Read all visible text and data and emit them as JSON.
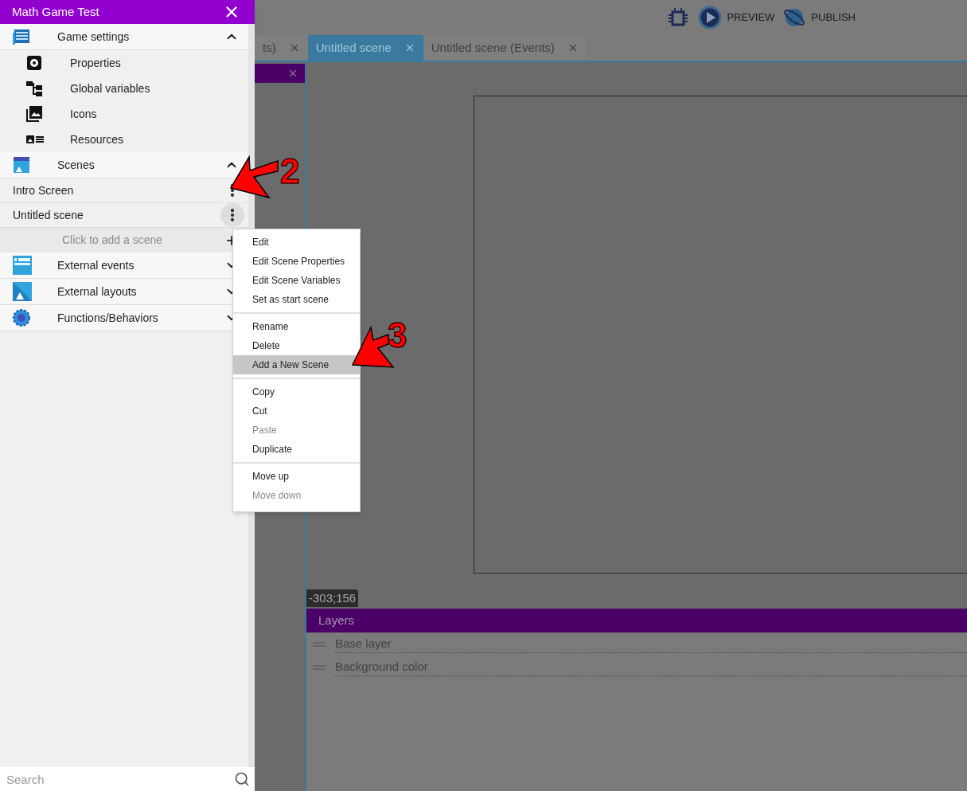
{
  "drawer": {
    "title": "Math Game Test",
    "sections": [
      {
        "kind": "settings",
        "label": "Game settings",
        "expanded": true,
        "items": [
          {
            "kind": "properties",
            "label": "Properties"
          },
          {
            "kind": "variables",
            "label": "Global variables"
          },
          {
            "kind": "icons",
            "label": "Icons"
          },
          {
            "kind": "resources",
            "label": "Resources"
          }
        ]
      },
      {
        "kind": "scenes",
        "label": "Scenes",
        "expanded": true,
        "scenes": [
          {
            "label": "Intro Screen",
            "menu_open": false
          },
          {
            "label": "Untitled scene",
            "menu_open": true
          }
        ],
        "add_placeholder": "Click to add a scene"
      },
      {
        "kind": "events",
        "label": "External events",
        "expanded": false
      },
      {
        "kind": "layouts",
        "label": "External layouts",
        "expanded": false
      },
      {
        "kind": "functions",
        "label": "Functions/Behaviors",
        "expanded": false
      }
    ],
    "search": {
      "placeholder": "Search"
    }
  },
  "toolbar": {
    "buttons": [
      {
        "kind": "preview",
        "label": "PREVIEW"
      },
      {
        "kind": "publish",
        "label": "PUBLISH"
      }
    ]
  },
  "tabs": [
    {
      "label": "ts)",
      "selected": false
    },
    {
      "label": "Untitled scene",
      "selected": true
    },
    {
      "label": "Untitled scene (Events)",
      "selected": false
    }
  ],
  "canvas": {
    "coordinates": "-303;156"
  },
  "layers": {
    "title": "Layers",
    "rows": [
      "Base layer",
      "Background color"
    ]
  },
  "context_menu": {
    "groups": [
      [
        {
          "label": "Edit",
          "selected": false,
          "disabled": false
        },
        {
          "label": "Edit Scene Properties",
          "selected": false,
          "disabled": false
        },
        {
          "label": "Edit Scene Variables",
          "selected": false,
          "disabled": false
        },
        {
          "label": "Set as start scene",
          "selected": false,
          "disabled": false
        }
      ],
      [
        {
          "label": "Rename",
          "selected": false,
          "disabled": false
        },
        {
          "label": "Delete",
          "selected": false,
          "disabled": false
        },
        {
          "label": "Add a New Scene",
          "selected": true,
          "disabled": false
        }
      ],
      [
        {
          "label": "Copy",
          "selected": false,
          "disabled": false
        },
        {
          "label": "Cut",
          "selected": false,
          "disabled": false
        },
        {
          "label": "Paste",
          "selected": false,
          "disabled": true
        },
        {
          "label": "Duplicate",
          "selected": false,
          "disabled": false
        }
      ],
      [
        {
          "label": "Move up",
          "selected": false,
          "disabled": false
        },
        {
          "label": "Move down",
          "selected": false,
          "disabled": true
        }
      ]
    ]
  },
  "annotations": [
    {
      "label": "2"
    },
    {
      "label": "3"
    }
  ]
}
